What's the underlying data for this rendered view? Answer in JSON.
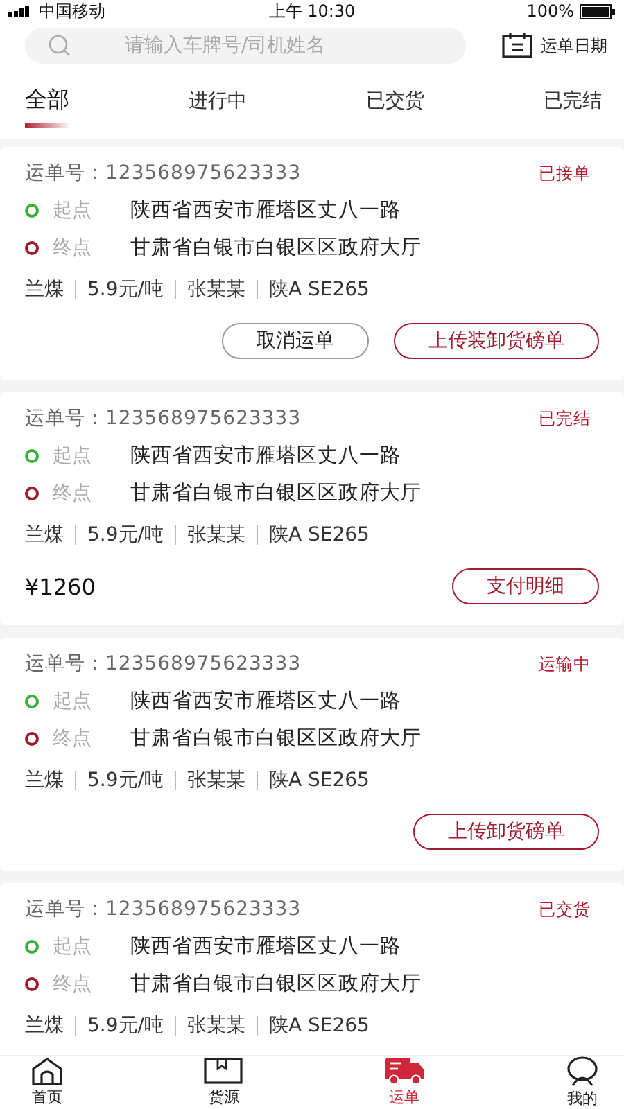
{
  "status_bar": {
    "carrier": "中国移动",
    "time": "上午 10:30",
    "battery": "100%"
  },
  "search": {
    "placeholder": "请输入车牌号/司机姓名"
  },
  "date_button": "运单日期",
  "tabs": [
    {
      "label": "全部",
      "selected": true
    },
    {
      "label": "进行中",
      "selected": false
    },
    {
      "label": "已交货",
      "selected": false
    },
    {
      "label": "已完结",
      "selected": false
    }
  ],
  "orders": [
    {
      "number_label": "运单号：",
      "number": "123568975623333",
      "status": "已接单",
      "origin_label": "起点",
      "origin": "陕西省西安市雁塔区丈八一路",
      "dest_label": "终点",
      "dest": "甘肃省白银市白银区区政府大厅",
      "cargo": [
        "兰煤",
        "5.9元/吨",
        "张某某",
        "陕A SE265"
      ],
      "actions": [
        {
          "label": "取消运单",
          "kind": "grey"
        },
        {
          "label": "上传装卸货磅单",
          "kind": "red"
        }
      ]
    },
    {
      "number_label": "运单号：",
      "number": "123568975623333",
      "status": "已完结",
      "origin_label": "起点",
      "origin": "陕西省西安市雁塔区丈八一路",
      "dest_label": "终点",
      "dest": "甘肃省白银市白银区区政府大厅",
      "cargo": [
        "兰煤",
        "5.9元/吨",
        "张某某",
        "陕A SE265"
      ],
      "price": "¥1260",
      "actions": [
        {
          "label": "支付明细",
          "kind": "red"
        }
      ]
    },
    {
      "number_label": "运单号：",
      "number": "123568975623333",
      "status": "运输中",
      "origin_label": "起点",
      "origin": "陕西省西安市雁塔区丈八一路",
      "dest_label": "终点",
      "dest": "甘肃省白银市白银区区政府大厅",
      "cargo": [
        "兰煤",
        "5.9元/吨",
        "张某某",
        "陕A SE265"
      ],
      "actions": [
        {
          "label": "上传卸货磅单",
          "kind": "red"
        }
      ]
    },
    {
      "number_label": "运单号：",
      "number": "123568975623333",
      "status": "已交货",
      "origin_label": "起点",
      "origin": "陕西省西安市雁塔区丈八一路",
      "dest_label": "终点",
      "dest": "甘肃省白银市白银区区政府大厅",
      "cargo": [
        "兰煤",
        "5.9元/吨",
        "张某某",
        "陕A SE265"
      ]
    }
  ],
  "nav": [
    {
      "label": "首页",
      "kind": "home",
      "selected": false
    },
    {
      "label": "货源",
      "kind": "box",
      "selected": false
    },
    {
      "label": "运单",
      "kind": "truck",
      "selected": true
    },
    {
      "label": "我的",
      "kind": "user",
      "selected": false
    }
  ]
}
